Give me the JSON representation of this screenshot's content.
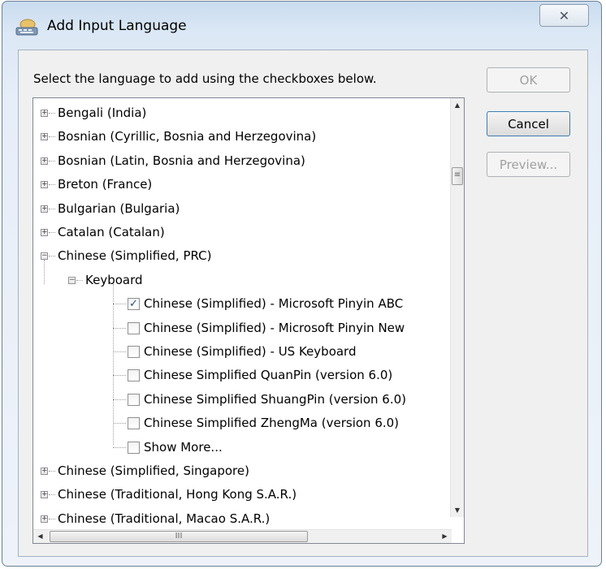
{
  "window": {
    "title": "Add Input Language",
    "close_glyph": "✕"
  },
  "instruction": "Select the language to add using the checkboxes below.",
  "buttons": {
    "ok": "OK",
    "cancel": "Cancel",
    "preview": "Preview..."
  },
  "tree": {
    "languages_before": [
      "Bengali (India)",
      "Bosnian (Cyrillic, Bosnia and Herzegovina)",
      "Bosnian (Latin, Bosnia and Herzegovina)",
      "Breton (France)",
      "Bulgarian (Bulgaria)",
      "Catalan (Catalan)"
    ],
    "expanded_language": "Chinese (Simplified, PRC)",
    "keyboard_group": "Keyboard",
    "keyboards": [
      {
        "label": "Chinese (Simplified) - Microsoft Pinyin ABC",
        "checked": true
      },
      {
        "label": "Chinese (Simplified) - Microsoft Pinyin New",
        "checked": false
      },
      {
        "label": "Chinese (Simplified) - US Keyboard",
        "checked": false
      },
      {
        "label": "Chinese Simplified QuanPin (version 6.0)",
        "checked": false
      },
      {
        "label": "Chinese Simplified ShuangPin (version 6.0)",
        "checked": false
      },
      {
        "label": "Chinese Simplified ZhengMa (version 6.0)",
        "checked": false
      },
      {
        "label": "Show More...",
        "checked": false
      }
    ],
    "languages_after": [
      "Chinese (Simplified, Singapore)",
      "Chinese (Traditional, Hong Kong S.A.R.)",
      "Chinese (Traditional, Macao S.A.R.)"
    ]
  },
  "icons": {
    "app": "keyboard-language-icon",
    "expand": "+",
    "collapse": "−",
    "check": "✓",
    "thumb_grip": "≡",
    "h_thumb_grip": "III",
    "arrow_up": "▲",
    "arrow_down": "▼",
    "arrow_left": "◀",
    "arrow_right": "▶"
  }
}
